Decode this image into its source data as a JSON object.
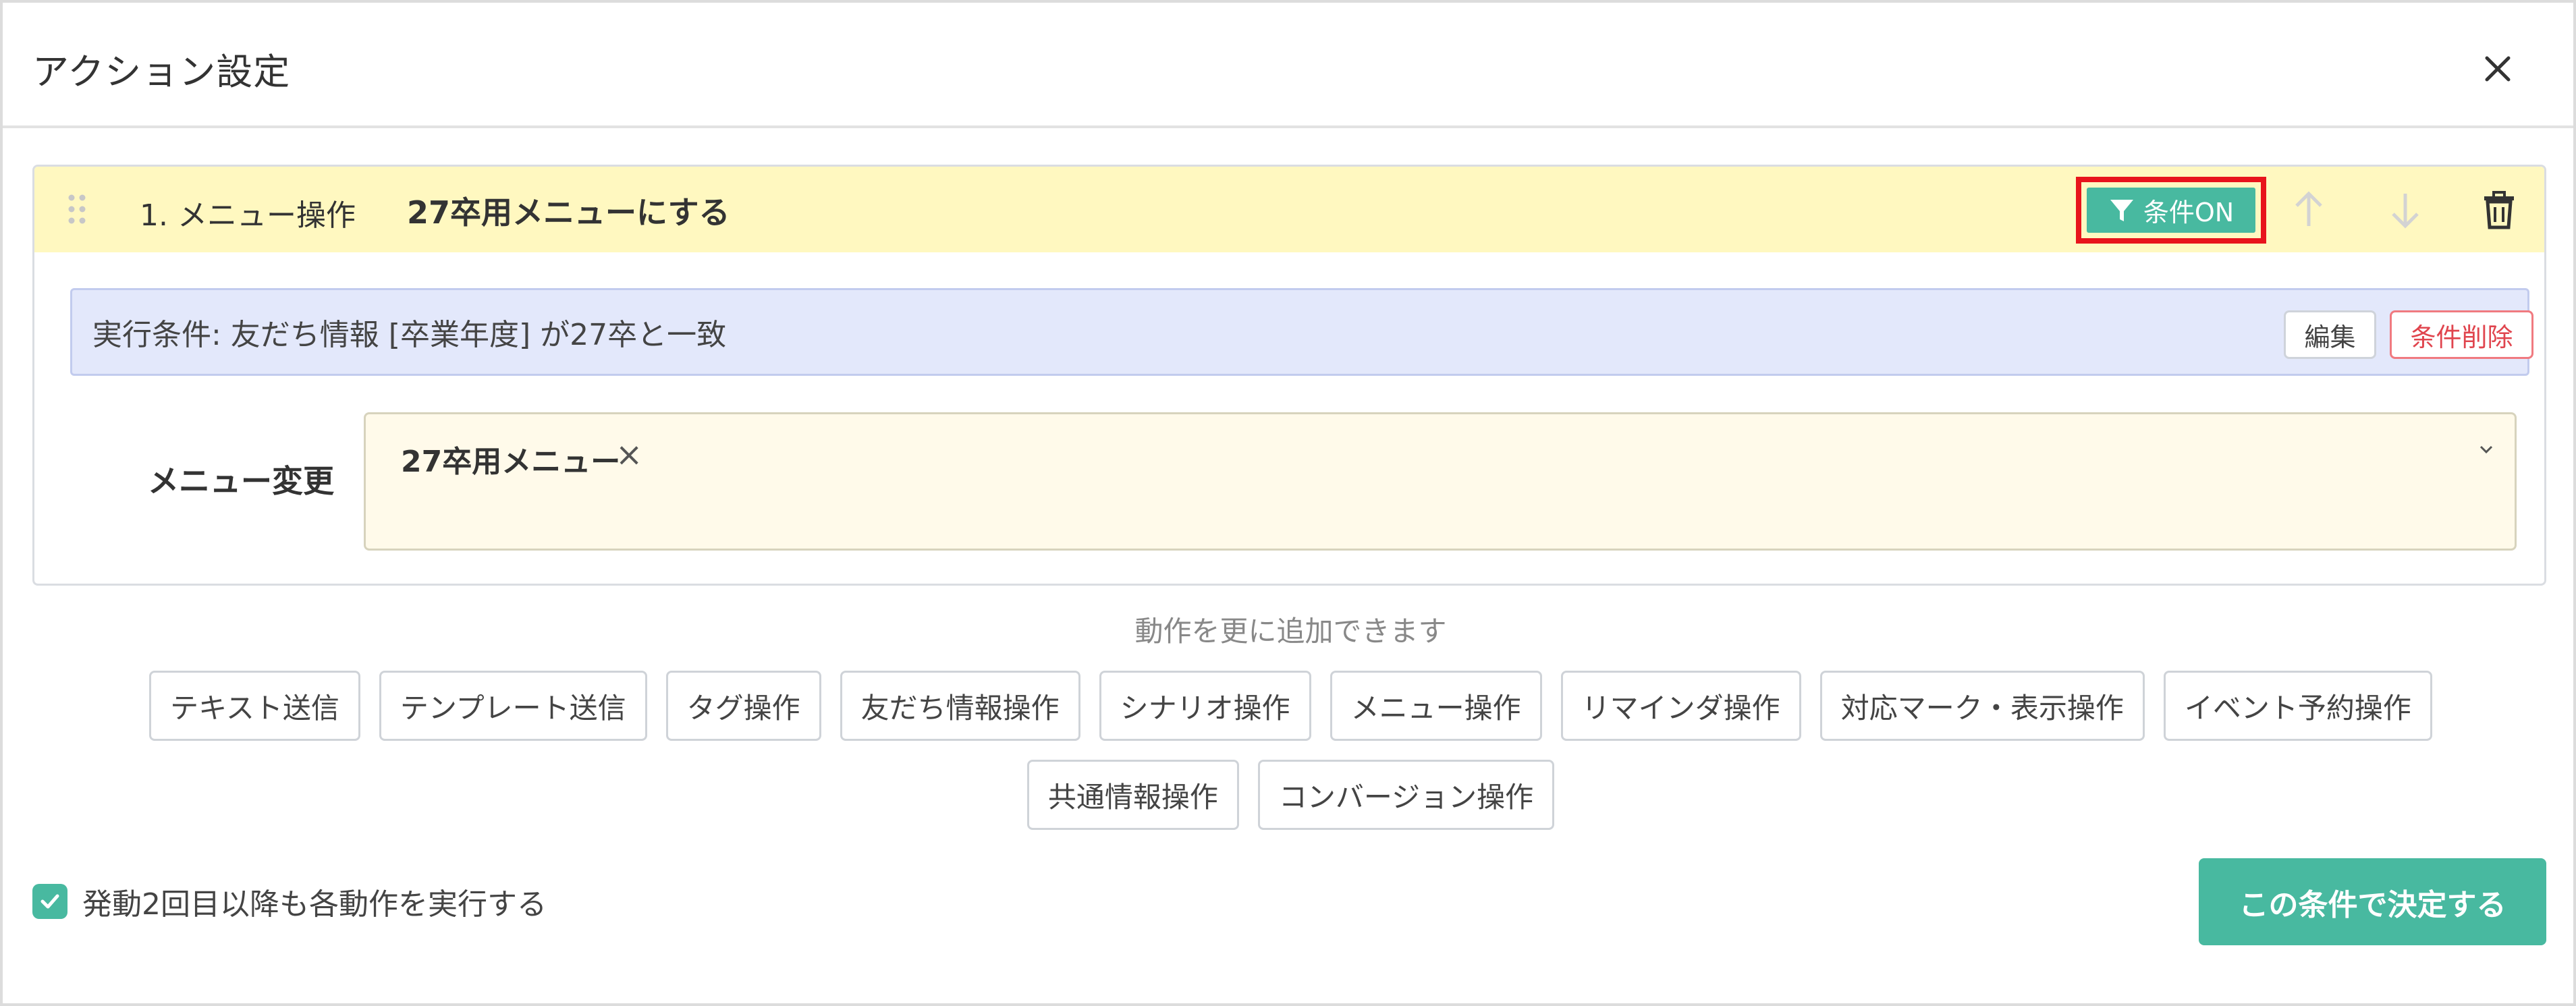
{
  "dialog": {
    "title": "アクション設定",
    "close_icon": "close-icon"
  },
  "action": {
    "number": "1. メニュー操作",
    "name": "27卒用メニューにする",
    "condition_button": "条件ON",
    "condition_button_icon": "filter-icon",
    "controls": [
      "arrow-up-icon",
      "arrow-down-icon",
      "trash-icon"
    ],
    "condition_text": "実行条件: 友だち情報 [卒業年度] が27卒と一致",
    "edit_label": "編集",
    "delete_condition_label": "条件削除",
    "menu_change_label": "メニュー変更",
    "menu_selected": "27卒用メニュー",
    "menu_remove": "×"
  },
  "operations": {
    "hint": "動作を更に追加できます",
    "row1": [
      "テキスト送信",
      "テンプレート送信",
      "タグ操作",
      "友だち情報操作",
      "シナリオ操作",
      "メニュー操作",
      "リマインダ操作",
      "対応マーク・表示操作",
      "イベント予約操作"
    ],
    "row2": [
      "共通情報操作",
      "コンバージョン操作"
    ]
  },
  "footer": {
    "checkbox_label": "発動2回目以降も各動作を実行する",
    "checkbox_checked": true,
    "submit_label": "この条件で決定する"
  },
  "colors": {
    "accent": "#48b9a0",
    "header_bg": "#fff8c0",
    "condition_bg": "#e3e8fb",
    "highlight_border": "#e8141c",
    "danger": "#e0454e"
  }
}
